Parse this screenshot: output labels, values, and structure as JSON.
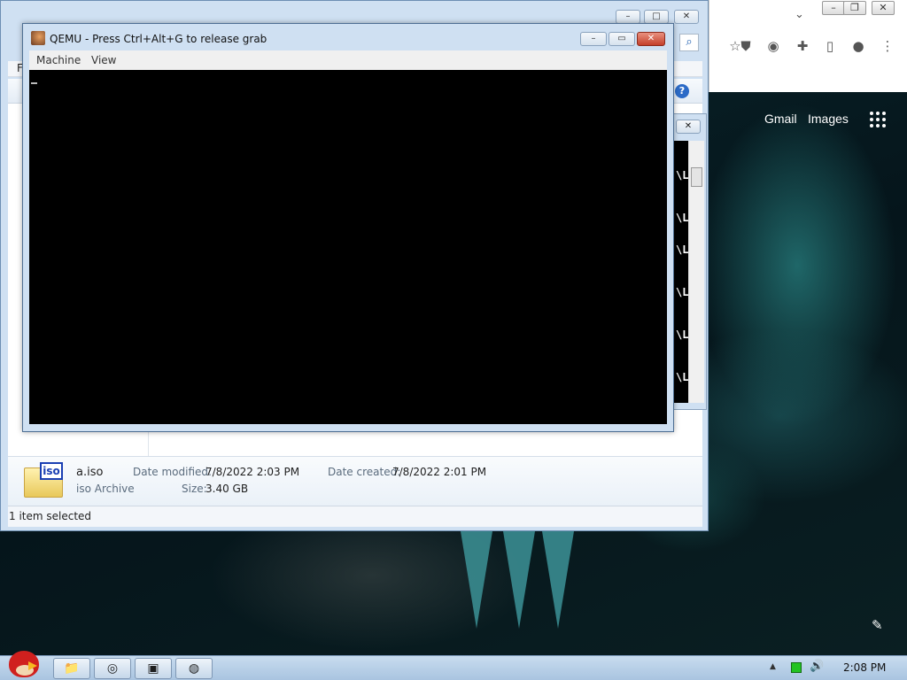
{
  "chrome": {
    "links": [
      "Gmail",
      "Images"
    ]
  },
  "explorer": {
    "menu_first_letter": "F",
    "file": {
      "name": "a.iso",
      "type": "iso Archive",
      "icon_label": "iso",
      "date_modified_key": "Date modified:",
      "date_modified": "7/8/2022 2:03 PM",
      "date_created_key": "Date created:",
      "date_created": "7/8/2022 2:01 PM",
      "size_key": "Size:",
      "size": "3.40 GB"
    },
    "status": "1 item selected"
  },
  "console_peek": {
    "fragment": "\\L"
  },
  "qemu": {
    "title": "QEMU - Press Ctrl+Alt+G to release grab",
    "menu": [
      "Machine",
      "View"
    ],
    "screen_color": "#000000"
  },
  "taskbar": {
    "clock": "2:08 PM",
    "tray_net_color": "#22c322"
  }
}
